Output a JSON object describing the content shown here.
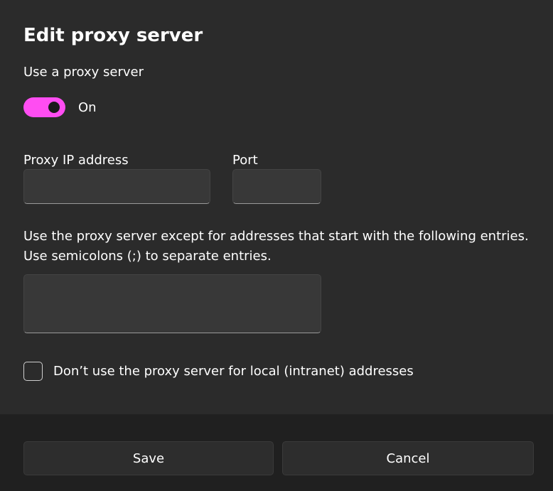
{
  "dialog": {
    "title": "Edit proxy server",
    "use_proxy_label": "Use a proxy server",
    "toggle": {
      "state": "On",
      "accent": "#ff4df2"
    },
    "proxy_ip_label": "Proxy IP address",
    "proxy_ip_value": "",
    "port_label": "Port",
    "port_value": "",
    "exceptions_line1": "Use the proxy server except for addresses that start with the following entries.",
    "exceptions_line2": "Use semicolons (;) to separate entries.",
    "exceptions_value": "",
    "local_checkbox_label": "Don’t use the proxy server for local (intranet) addresses",
    "local_checkbox_checked": false
  },
  "footer": {
    "save_label": "Save",
    "cancel_label": "Cancel"
  }
}
